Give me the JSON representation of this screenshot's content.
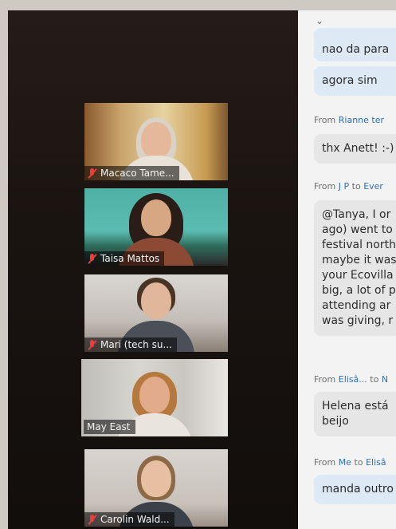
{
  "participants": [
    {
      "name": "Macaco Tame...",
      "muted": true
    },
    {
      "name": "Taisa Mattos",
      "muted": true
    },
    {
      "name": "Mari (tech su...",
      "muted": true
    },
    {
      "name": "May East",
      "muted": false,
      "active_speaker": true
    },
    {
      "name": "Carolin Wald...",
      "muted": true
    }
  ],
  "chat": {
    "top_fragment": "nao da para",
    "messages": [
      {
        "text_lines": [
          "agora sim"
        ]
      },
      {
        "from_prefix": "From",
        "sender": "Rianne ter",
        "recipient_prefix": "",
        "recipient": "",
        "text_lines": [
          "thx Anett! :-)"
        ]
      },
      {
        "from_prefix": "From",
        "sender": "J P",
        "recipient_prefix": "to",
        "recipient": "Ever",
        "text_lines": [
          "@Tanya, I or",
          "ago)  went to",
          "festival north",
          "maybe it was",
          "your Ecovilla",
          "big, a lot of p",
          "attending ar",
          "was giving, r"
        ]
      },
      {
        "from_prefix": "From",
        "sender": "Elisâ...",
        "recipient_prefix": "to",
        "recipient": "N",
        "text_lines": [
          "Helena está",
          "beijo"
        ]
      },
      {
        "from_prefix": "From",
        "sender": "Me",
        "recipient_prefix": "to",
        "recipient": "Elisâ",
        "text_lines": [
          "manda outro"
        ]
      }
    ]
  },
  "colors": {
    "active_speaker_border": "#e2e27a",
    "muted_icon": "#ee3b3b",
    "sender_link": "#2e6fb8",
    "my_bubble": "#dde9f4"
  }
}
